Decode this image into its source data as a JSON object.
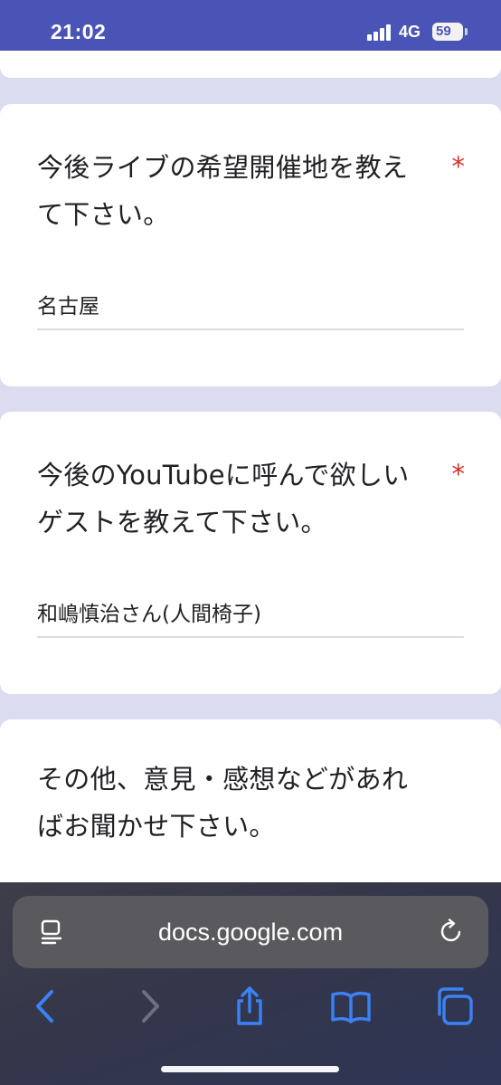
{
  "status_bar": {
    "time": "21:02",
    "network": "4G",
    "battery": "59"
  },
  "form": {
    "questions": [
      {
        "line1": "今後ライブの希望開催地を教え",
        "line2": "て下さい。",
        "required_mark": "*",
        "answer": "名古屋"
      },
      {
        "line1": "今後のYouTubeに呼んで欲しい",
        "line2": "ゲストを教えて下さい。",
        "required_mark": "*",
        "answer": "和嶋慎治さん(人間椅子)"
      },
      {
        "line1": "その他、意見・感想などがあれ",
        "line2": "ばお聞かせ下さい。"
      }
    ]
  },
  "browser": {
    "url": "docs.google.com",
    "icons": {
      "reader": "reader-mode-icon",
      "reload": "reload-icon",
      "back": "back-chevron-icon",
      "forward": "forward-chevron-icon",
      "share": "share-icon",
      "bookmarks": "book-icon",
      "tabs": "tabs-icon"
    },
    "colors": {
      "accent": "#3b82f6",
      "disabled": "#6b6f80",
      "form_header": "#4a54b6",
      "required": "#d93025"
    }
  }
}
